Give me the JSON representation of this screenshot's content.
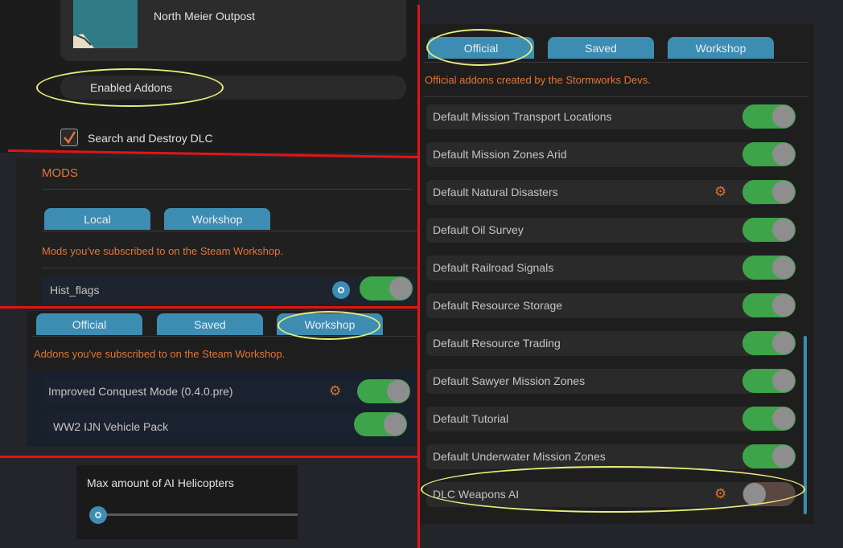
{
  "top_left": {
    "location_name": "North Meier Outpost",
    "enabled_addons_label": "Enabled Addons",
    "dlc_checkbox_label": "Search and Destroy DLC",
    "dlc_checked": true
  },
  "mods_panel": {
    "heading": "MODS",
    "tabs": [
      "Local",
      "Workshop"
    ],
    "description": "Mods you've subscribed to on the Steam Workshop.",
    "items": [
      {
        "label": "Hist_flags",
        "enabled": true
      }
    ]
  },
  "addons_workshop_panel": {
    "tabs": [
      "Official",
      "Saved",
      "Workshop"
    ],
    "description": "Addons you've subscribed to on the Steam Workshop.",
    "items": [
      {
        "label": "Improved Conquest Mode (0.4.0.pre)",
        "enabled": true,
        "has_settings": true
      },
      {
        "label": "WW2 IJN Vehicle Pack",
        "enabled": true,
        "has_settings": false
      }
    ]
  },
  "slider_panel": {
    "label": "Max amount of AI Helicopters",
    "value_fraction": 0.0
  },
  "official_panel": {
    "tabs": [
      "Official",
      "Saved",
      "Workshop"
    ],
    "description": "Official addons created by the Stormworks Devs.",
    "items": [
      {
        "label": "Default Mission Transport Locations",
        "enabled": true,
        "has_settings": false
      },
      {
        "label": "Default Mission Zones Arid",
        "enabled": true,
        "has_settings": false
      },
      {
        "label": "Default Natural Disasters",
        "enabled": true,
        "has_settings": true
      },
      {
        "label": "Default Oil Survey",
        "enabled": true,
        "has_settings": false
      },
      {
        "label": "Default Railroad Signals",
        "enabled": true,
        "has_settings": false
      },
      {
        "label": "Default Resource Storage",
        "enabled": true,
        "has_settings": false
      },
      {
        "label": "Default Resource Trading",
        "enabled": true,
        "has_settings": false
      },
      {
        "label": "Default Sawyer Mission Zones",
        "enabled": true,
        "has_settings": false
      },
      {
        "label": "Default Tutorial",
        "enabled": true,
        "has_settings": false
      },
      {
        "label": "Default Underwater Mission Zones",
        "enabled": true,
        "has_settings": false
      },
      {
        "label": "DLC Weapons AI",
        "enabled": false,
        "has_settings": true
      }
    ]
  },
  "colors": {
    "tab": "#3d8db3",
    "toggle_on": "#3ea44a",
    "toggle_off": "#5a4742",
    "description_text": "#e0763a",
    "annotation_line": "#e21515",
    "annotation_circle": "#e8ee7a"
  }
}
